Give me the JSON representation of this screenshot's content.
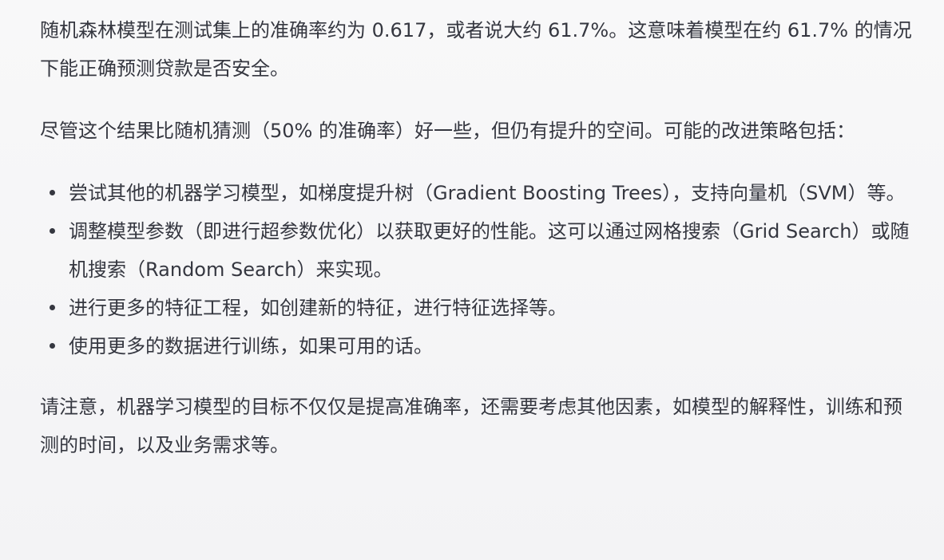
{
  "message": {
    "intro_paragraph": "随机森林模型在测试集上的准确率约为 0.617，或者说大约 61.7%。这意味着模型在约 61.7% 的情况下能正确预测贷款是否安全。",
    "analysis_paragraph": "尽管这个结果比随机猜测（50% 的准确率）好一些，但仍有提升的空间。可能的改进策略包括：",
    "bullets": [
      "尝试其他的机器学习模型，如梯度提升树（Gradient Boosting Trees），支持向量机（SVM）等。",
      "调整模型参数（即进行超参数优化）以获取更好的性能。这可以通过网格搜索（Grid Search）或随机搜索（Random Search）来实现。",
      "进行更多的特征工程，如创建新的特征，进行特征选择等。",
      "使用更多的数据进行训练，如果可用的话。"
    ],
    "closing_paragraph": "请注意，机器学习模型的目标不仅仅是提高准确率，还需要考虑其他因素，如模型的解释性，训练和预测的时间，以及业务需求等。"
  }
}
